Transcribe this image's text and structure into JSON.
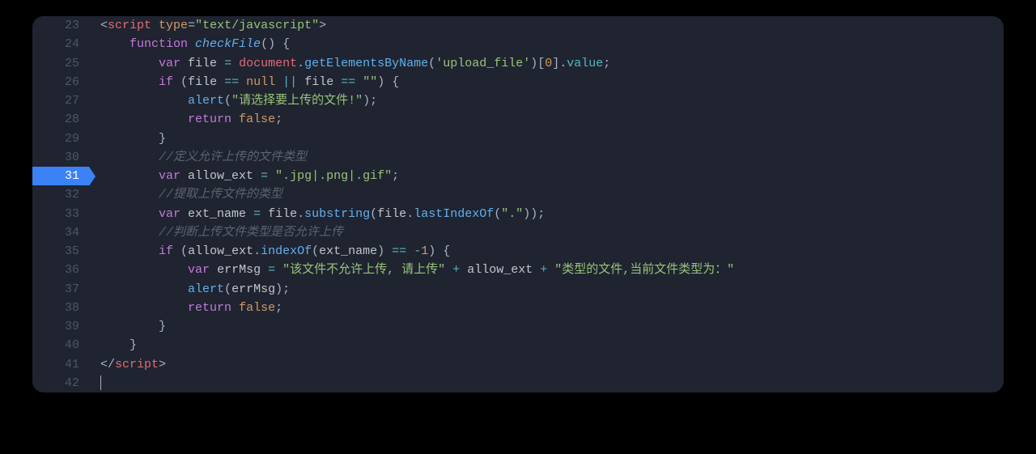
{
  "startLine": 23,
  "highlightLine": 31,
  "lines": [
    [
      {
        "c": "t-pun",
        "t": "<"
      },
      {
        "c": "t-tag",
        "t": "script"
      },
      {
        "c": "",
        "t": " "
      },
      {
        "c": "t-attr",
        "t": "type"
      },
      {
        "c": "t-pun",
        "t": "="
      },
      {
        "c": "t-str",
        "t": "\"text/javascript\""
      },
      {
        "c": "t-pun",
        "t": ">"
      }
    ],
    [
      {
        "c": "",
        "t": "    "
      },
      {
        "c": "t-key",
        "t": "function"
      },
      {
        "c": "",
        "t": " "
      },
      {
        "c": "t-def",
        "t": "checkFile"
      },
      {
        "c": "t-pun",
        "t": "() {"
      }
    ],
    [
      {
        "c": "",
        "t": "        "
      },
      {
        "c": "t-store",
        "t": "var"
      },
      {
        "c": "",
        "t": " "
      },
      {
        "c": "t-id",
        "t": "file"
      },
      {
        "c": "",
        "t": " "
      },
      {
        "c": "t-op",
        "t": "="
      },
      {
        "c": "",
        "t": " "
      },
      {
        "c": "t-ide",
        "t": "document"
      },
      {
        "c": "t-pun",
        "t": "."
      },
      {
        "c": "t-call",
        "t": "getElementsByName"
      },
      {
        "c": "t-pun",
        "t": "("
      },
      {
        "c": "t-str",
        "t": "'upload_file'"
      },
      {
        "c": "t-pun",
        "t": ")["
      },
      {
        "c": "t-num",
        "t": "0"
      },
      {
        "c": "t-pun",
        "t": "]."
      },
      {
        "c": "t-mem",
        "t": "value"
      },
      {
        "c": "t-pun",
        "t": ";"
      }
    ],
    [
      {
        "c": "",
        "t": "        "
      },
      {
        "c": "t-key",
        "t": "if"
      },
      {
        "c": "",
        "t": " "
      },
      {
        "c": "t-pun",
        "t": "("
      },
      {
        "c": "t-id",
        "t": "file"
      },
      {
        "c": "",
        "t": " "
      },
      {
        "c": "t-op",
        "t": "=="
      },
      {
        "c": "",
        "t": " "
      },
      {
        "c": "t-con",
        "t": "null"
      },
      {
        "c": "",
        "t": " "
      },
      {
        "c": "t-op",
        "t": "||"
      },
      {
        "c": "",
        "t": " "
      },
      {
        "c": "t-id",
        "t": "file"
      },
      {
        "c": "",
        "t": " "
      },
      {
        "c": "t-op",
        "t": "=="
      },
      {
        "c": "",
        "t": " "
      },
      {
        "c": "t-str",
        "t": "\"\""
      },
      {
        "c": "t-pun",
        "t": ") {"
      }
    ],
    [
      {
        "c": "",
        "t": "            "
      },
      {
        "c": "t-call",
        "t": "alert"
      },
      {
        "c": "t-pun",
        "t": "("
      },
      {
        "c": "t-str",
        "t": "\"请选择要上传的文件!\""
      },
      {
        "c": "t-pun",
        "t": ");"
      }
    ],
    [
      {
        "c": "",
        "t": "            "
      },
      {
        "c": "t-key",
        "t": "return"
      },
      {
        "c": "",
        "t": " "
      },
      {
        "c": "t-con",
        "t": "false"
      },
      {
        "c": "t-pun",
        "t": ";"
      }
    ],
    [
      {
        "c": "",
        "t": "        "
      },
      {
        "c": "t-pun",
        "t": "}"
      }
    ],
    [
      {
        "c": "",
        "t": "        "
      },
      {
        "c": "t-com",
        "t": "//定义允许上传的文件类型"
      }
    ],
    [
      {
        "c": "",
        "t": "        "
      },
      {
        "c": "t-store",
        "t": "var"
      },
      {
        "c": "",
        "t": " "
      },
      {
        "c": "t-id",
        "t": "allow_ext"
      },
      {
        "c": "",
        "t": " "
      },
      {
        "c": "t-op",
        "t": "="
      },
      {
        "c": "",
        "t": " "
      },
      {
        "c": "t-str",
        "t": "\".jpg|.png|.gif\""
      },
      {
        "c": "t-pun",
        "t": ";"
      }
    ],
    [
      {
        "c": "",
        "t": "        "
      },
      {
        "c": "t-com",
        "t": "//提取上传文件的类型"
      }
    ],
    [
      {
        "c": "",
        "t": "        "
      },
      {
        "c": "t-store",
        "t": "var"
      },
      {
        "c": "",
        "t": " "
      },
      {
        "c": "t-id",
        "t": "ext_name"
      },
      {
        "c": "",
        "t": " "
      },
      {
        "c": "t-op",
        "t": "="
      },
      {
        "c": "",
        "t": " "
      },
      {
        "c": "t-id",
        "t": "file"
      },
      {
        "c": "t-pun",
        "t": "."
      },
      {
        "c": "t-call",
        "t": "substring"
      },
      {
        "c": "t-pun",
        "t": "("
      },
      {
        "c": "t-id",
        "t": "file"
      },
      {
        "c": "t-pun",
        "t": "."
      },
      {
        "c": "t-call",
        "t": "lastIndexOf"
      },
      {
        "c": "t-pun",
        "t": "("
      },
      {
        "c": "t-str",
        "t": "\".\""
      },
      {
        "c": "t-pun",
        "t": "));"
      }
    ],
    [
      {
        "c": "",
        "t": "        "
      },
      {
        "c": "t-com",
        "t": "//判断上传文件类型是否允许上传"
      }
    ],
    [
      {
        "c": "",
        "t": "        "
      },
      {
        "c": "t-key",
        "t": "if"
      },
      {
        "c": "",
        "t": " "
      },
      {
        "c": "t-pun",
        "t": "("
      },
      {
        "c": "t-id",
        "t": "allow_ext"
      },
      {
        "c": "t-pun",
        "t": "."
      },
      {
        "c": "t-call",
        "t": "indexOf"
      },
      {
        "c": "t-pun",
        "t": "("
      },
      {
        "c": "t-id",
        "t": "ext_name"
      },
      {
        "c": "t-pun",
        "t": ") "
      },
      {
        "c": "t-op",
        "t": "=="
      },
      {
        "c": "",
        "t": " "
      },
      {
        "c": "t-op",
        "t": "-"
      },
      {
        "c": "t-num",
        "t": "1"
      },
      {
        "c": "t-pun",
        "t": ") {"
      }
    ],
    [
      {
        "c": "",
        "t": "            "
      },
      {
        "c": "t-store",
        "t": "var"
      },
      {
        "c": "",
        "t": " "
      },
      {
        "c": "t-id",
        "t": "errMsg"
      },
      {
        "c": "",
        "t": " "
      },
      {
        "c": "t-op",
        "t": "="
      },
      {
        "c": "",
        "t": " "
      },
      {
        "c": "t-str",
        "t": "\"该文件不允许上传, 请上传\""
      },
      {
        "c": "",
        "t": " "
      },
      {
        "c": "t-op",
        "t": "+"
      },
      {
        "c": "",
        "t": " "
      },
      {
        "c": "t-id",
        "t": "allow_ext"
      },
      {
        "c": "",
        "t": " "
      },
      {
        "c": "t-op",
        "t": "+"
      },
      {
        "c": "",
        "t": " "
      },
      {
        "c": "t-str",
        "t": "\"类型的文件,当前文件类型为：\""
      }
    ],
    [
      {
        "c": "",
        "t": "            "
      },
      {
        "c": "t-call",
        "t": "alert"
      },
      {
        "c": "t-pun",
        "t": "("
      },
      {
        "c": "t-id",
        "t": "errMsg"
      },
      {
        "c": "t-pun",
        "t": ");"
      }
    ],
    [
      {
        "c": "",
        "t": "            "
      },
      {
        "c": "t-key",
        "t": "return"
      },
      {
        "c": "",
        "t": " "
      },
      {
        "c": "t-con",
        "t": "false"
      },
      {
        "c": "t-pun",
        "t": ";"
      }
    ],
    [
      {
        "c": "",
        "t": "        "
      },
      {
        "c": "t-pun",
        "t": "}"
      }
    ],
    [
      {
        "c": "",
        "t": "    "
      },
      {
        "c": "t-pun",
        "t": "}"
      }
    ],
    [
      {
        "c": "t-pun",
        "t": "</"
      },
      {
        "c": "t-tag",
        "t": "script"
      },
      {
        "c": "t-pun",
        "t": ">"
      }
    ],
    [
      {
        "c": "",
        "t": ""
      }
    ]
  ]
}
